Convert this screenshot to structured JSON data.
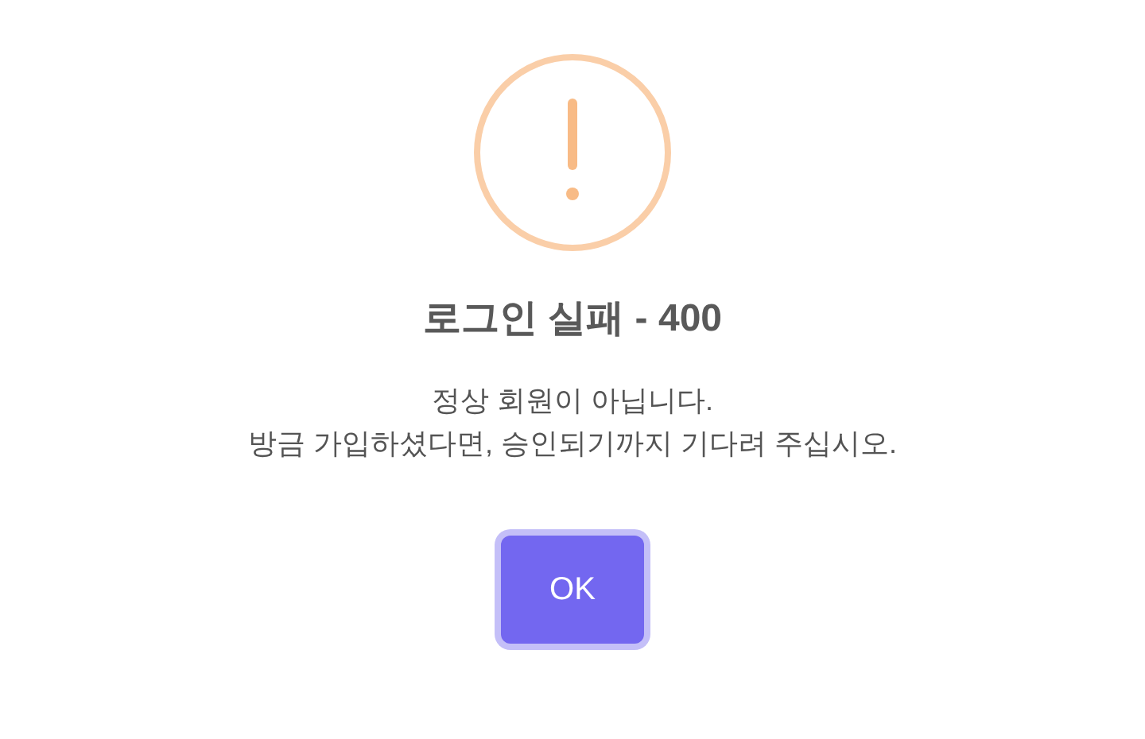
{
  "dialog": {
    "icon": {
      "kind": "warning"
    },
    "title": "로그인 실패 - 400",
    "message": [
      "정상 회원이 아닙니다.",
      "방금 가입하셨다면, 승인되기까지 기다려 주십시오."
    ],
    "buttons": [
      {
        "label": "OK",
        "focused": true
      }
    ]
  }
}
